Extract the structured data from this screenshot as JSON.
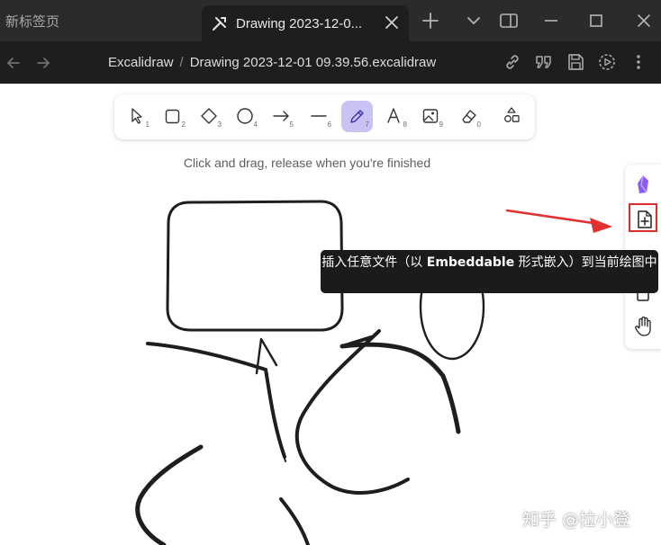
{
  "tabs": {
    "inactive_tab_label": "新标签页",
    "active_tab_label": "Drawing 2023-12-0...",
    "active_tab_icon": "excalidraw-icon"
  },
  "window_controls": [
    "new-tab",
    "tab-list",
    "split-view",
    "minimize",
    "maximize",
    "close"
  ],
  "breadcrumb": {
    "folder": "Excalidraw",
    "separator": "/",
    "file": "Drawing 2023-12-01 09.39.56.excalidraw"
  },
  "nav_actions": [
    "link-icon",
    "quote-icon",
    "save-icon",
    "play-icon",
    "more-icon"
  ],
  "toolbar": {
    "tools": [
      {
        "name": "selection",
        "shortcut": "1"
      },
      {
        "name": "rectangle",
        "shortcut": "2"
      },
      {
        "name": "diamond",
        "shortcut": "3"
      },
      {
        "name": "ellipse",
        "shortcut": "4"
      },
      {
        "name": "arrow",
        "shortcut": "5"
      },
      {
        "name": "line",
        "shortcut": "6"
      },
      {
        "name": "draw",
        "shortcut": "7",
        "active": true
      },
      {
        "name": "text",
        "shortcut": "8"
      },
      {
        "name": "image",
        "shortcut": "9"
      },
      {
        "name": "eraser",
        "shortcut": "0"
      },
      {
        "name": "library"
      }
    ],
    "active_color": "#c9c3f5"
  },
  "hint": "Click and drag, release when you're finished",
  "side_toolbar": {
    "buttons": [
      "obsidian-icon",
      "insert-embeddable-icon",
      "lock-icon",
      "hand-icon"
    ],
    "highlight_color": "#d9302b"
  },
  "tooltip": {
    "before": "插入任意文件（以 ",
    "bold": "Embeddable",
    "after": " 形式嵌入）到当前绘图中"
  },
  "watermark": "知乎 @拉小登",
  "annotation_arrow_color": "#e03030"
}
